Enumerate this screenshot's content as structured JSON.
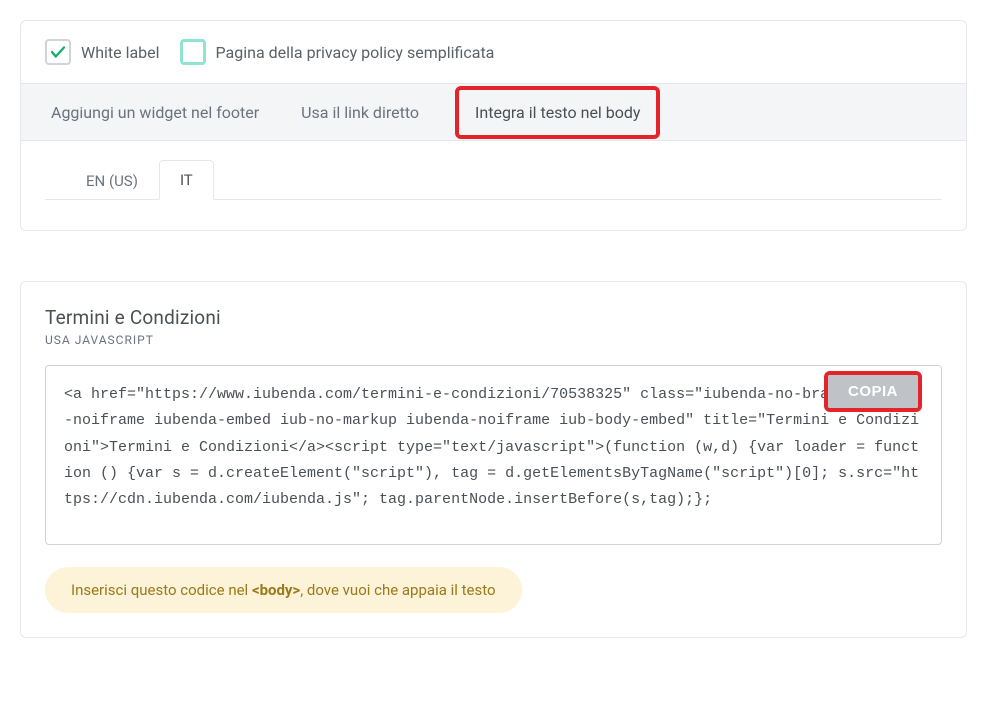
{
  "checkboxes": {
    "white_label": {
      "label": "White label",
      "checked": true
    },
    "simplified_privacy": {
      "label": "Pagina della privacy policy semplificata",
      "checked": false
    }
  },
  "integration_tabs": {
    "widget_footer": "Aggiungi un widget nel footer",
    "direct_link": "Usa il link diretto",
    "embed_body": "Integra il testo nel body"
  },
  "lang_tabs": {
    "en": "EN (US)",
    "it": "IT"
  },
  "terms_section": {
    "title": "Termini e Condizioni",
    "subtitle": "USA JAVASCRIPT",
    "code": "<a href=\"https://www.iubenda.com/termini-e-condizioni/70538325\" class=\"iubenda-no-brand iubenda-noiframe iubenda-embed iub-no-markup iubenda-noiframe iub-body-embed\" title=\"Termini e Condizioni\">Termini e Condizioni</a><script type=\"text/javascript\">(function (w,d) {var loader = function () {var s = d.createElement(\"script\"), tag = d.getElementsByTagName(\"script\")[0]; s.src=\"https://cdn.iubenda.com/iubenda.js\"; tag.parentNode.insertBefore(s,tag);};",
    "copy_button": "COPIA",
    "hint_prefix": "Inserisci questo codice nel ",
    "hint_bold": "<body>",
    "hint_suffix": ", dove vuoi che appaia il testo"
  }
}
